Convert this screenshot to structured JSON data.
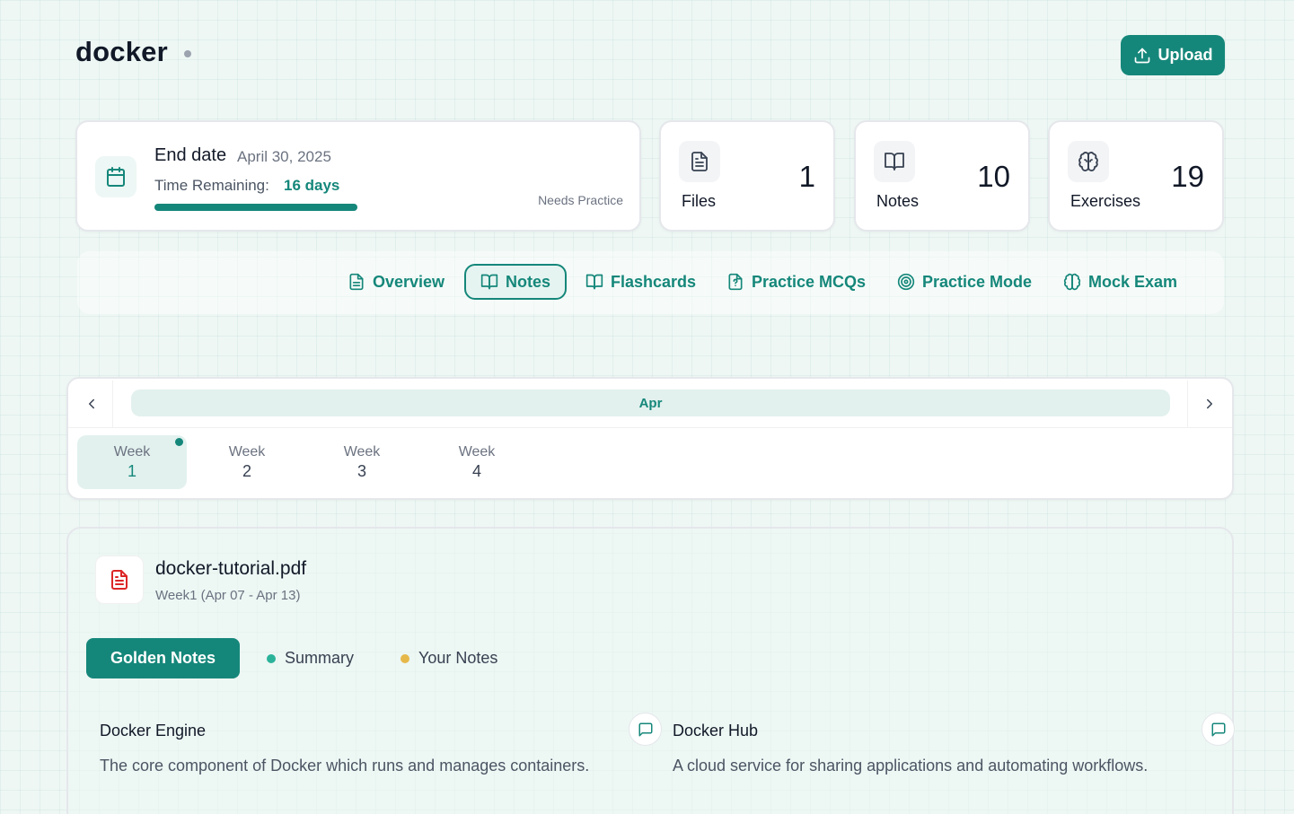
{
  "header": {
    "title": "docker",
    "upload_label": "Upload"
  },
  "schedule": {
    "end_date_label": "End date",
    "end_date_value": "April 30, 2025",
    "time_remaining_label": "Time Remaining:",
    "time_remaining_value": "16 days",
    "status": "Needs Practice",
    "progress_fraction": 1.0
  },
  "stats": [
    {
      "label": "Files",
      "value": "1",
      "icon": "file-text-icon"
    },
    {
      "label": "Notes",
      "value": "10",
      "icon": "book-open-icon"
    },
    {
      "label": "Exercises",
      "value": "19",
      "icon": "brain-icon"
    }
  ],
  "tabs": [
    {
      "label": "Overview",
      "icon": "file-text-icon",
      "active": false
    },
    {
      "label": "Notes",
      "icon": "book-open-icon",
      "active": true
    },
    {
      "label": "Flashcards",
      "icon": "book-open-icon",
      "active": false
    },
    {
      "label": "Practice MCQs",
      "icon": "file-question-icon",
      "active": false
    },
    {
      "label": "Practice Mode",
      "icon": "target-icon",
      "active": false
    },
    {
      "label": "Mock Exam",
      "icon": "brain-icon",
      "active": false
    }
  ],
  "weeks": {
    "month": "Apr",
    "items": [
      {
        "label": "Week",
        "number": "1",
        "active": true,
        "has_dot": true
      },
      {
        "label": "Week",
        "number": "2",
        "active": false,
        "has_dot": false
      },
      {
        "label": "Week",
        "number": "3",
        "active": false,
        "has_dot": false
      },
      {
        "label": "Week",
        "number": "4",
        "active": false,
        "has_dot": false
      }
    ]
  },
  "file": {
    "name": "docker-tutorial.pdf",
    "week_range": "Week1 (Apr 07 - Apr 13)"
  },
  "note_tabs": [
    {
      "label": "Golden Notes",
      "active": true
    },
    {
      "label": "Summary",
      "dot_color": "#2bb39a"
    },
    {
      "label": "Your Notes",
      "dot_color": "#e6b84a"
    }
  ],
  "notes": [
    {
      "title": "Docker Engine",
      "description": "The core component of Docker which runs and manages containers."
    },
    {
      "title": "Docker Hub",
      "description": "A cloud service for sharing applications and automating workflows."
    }
  ],
  "colors": {
    "accent": "#15877a",
    "accent_light": "#e2f1ee",
    "pdf_red": "#dc2626"
  }
}
